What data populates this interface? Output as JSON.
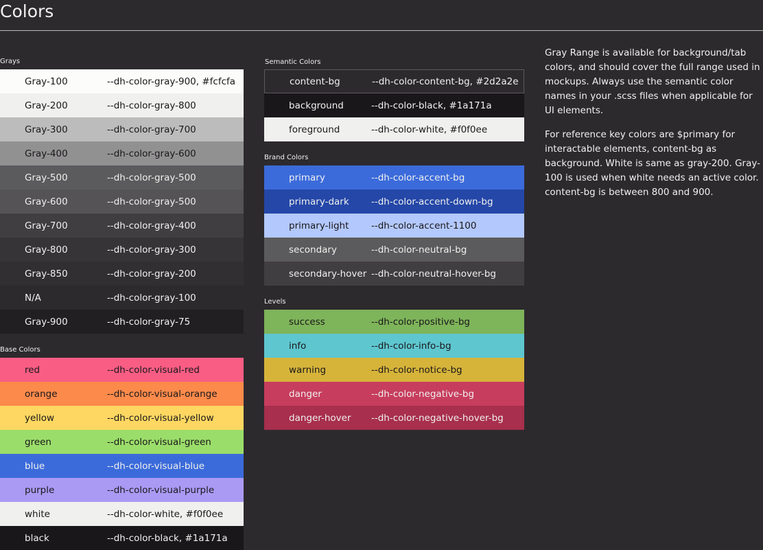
{
  "page": {
    "title": "Colors"
  },
  "grays": {
    "label": "Grays",
    "items": [
      {
        "name": "Gray-100",
        "var": "--dh-color-gray-900, #fcfcfa",
        "bg": "#fcfcfa",
        "fg": "#1a171a"
      },
      {
        "name": "Gray-200",
        "var": "--dh-color-gray-800",
        "bg": "#f0f0ee",
        "fg": "#1a171a"
      },
      {
        "name": "Gray-300",
        "var": "--dh-color-gray-700",
        "bg": "#bcbcbc",
        "fg": "#1a171a"
      },
      {
        "name": "Gray-400",
        "var": "--dh-color-gray-600",
        "bg": "#929192",
        "fg": "#1a171a"
      },
      {
        "name": "Gray-500",
        "var": "--dh-color-gray-500",
        "bg": "#5b5a5c",
        "fg": "#f0f0ee"
      },
      {
        "name": "Gray-600",
        "var": "--dh-color-gray-500",
        "bg": "#555356",
        "fg": "#f0f0ee"
      },
      {
        "name": "Gray-700",
        "var": "--dh-color-gray-400",
        "bg": "#403e41",
        "fg": "#f0f0ee"
      },
      {
        "name": "Gray-800",
        "var": "--dh-color-gray-300",
        "bg": "#373438",
        "fg": "#f0f0ee"
      },
      {
        "name": "Gray-850",
        "var": "--dh-color-gray-200",
        "bg": "#322f33",
        "fg": "#f0f0ee"
      },
      {
        "name": "N/A",
        "var": "--dh-color-gray-100",
        "bg": "#2d2a2e",
        "fg": "#f0f0ee"
      },
      {
        "name": "Gray-900",
        "var": "--dh-color-gray-75",
        "bg": "#211f22",
        "fg": "#f0f0ee"
      }
    ]
  },
  "base_colors": {
    "label": "Base Colors",
    "items": [
      {
        "name": "red",
        "var": "--dh-color-visual-red",
        "bg": "#f95d84",
        "fg": "#1a171a"
      },
      {
        "name": "orange",
        "var": "--dh-color-visual-orange",
        "bg": "#fc8a4b",
        "fg": "#1a171a"
      },
      {
        "name": "yellow",
        "var": "--dh-color-visual-yellow",
        "bg": "#fdd761",
        "fg": "#1a171a"
      },
      {
        "name": "green",
        "var": "--dh-color-visual-green",
        "bg": "#9bdd6a",
        "fg": "#1a171a"
      },
      {
        "name": "blue",
        "var": "--dh-color-visual-blue",
        "bg": "#3b6bdb",
        "fg": "#f0f0ee"
      },
      {
        "name": "purple",
        "var": "--dh-color-visual-purple",
        "bg": "#aa9af4",
        "fg": "#1a171a"
      },
      {
        "name": "white",
        "var": "--dh-color-white, #f0f0ee",
        "bg": "#f0f0ee",
        "fg": "#1a171a"
      },
      {
        "name": "black",
        "var": "--dh-color-black, #1a171a",
        "bg": "#1a171a",
        "fg": "#f0f0ee"
      }
    ]
  },
  "semantic_colors": {
    "label": "Semantic Colors",
    "items": [
      {
        "name": "content-bg",
        "var": "--dh-color-content-bg, #2d2a2e",
        "bg": "#2d2a2e",
        "fg": "#f0f0ee",
        "border": "#5b5a5c"
      },
      {
        "name": "background",
        "var": "--dh-color-black, #1a171a",
        "bg": "#1a171a",
        "fg": "#f0f0ee"
      },
      {
        "name": "foreground",
        "var": "--dh-color-white, #f0f0ee",
        "bg": "#f0f0ee",
        "fg": "#1a171a"
      }
    ]
  },
  "brand_colors": {
    "label": "Brand Colors",
    "items": [
      {
        "name": "primary",
        "var": "--dh-color-accent-bg",
        "bg": "#3b6bdb",
        "fg": "#f0f0ee"
      },
      {
        "name": "primary-dark",
        "var": "--dh-color-accent-down-bg",
        "bg": "#2447a8",
        "fg": "#f0f0ee"
      },
      {
        "name": "primary-light",
        "var": "--dh-color-accent-1100",
        "bg": "#b3c8fc",
        "fg": "#1a171a"
      },
      {
        "name": "secondary",
        "var": "--dh-color-neutral-bg",
        "bg": "#5b5a5c",
        "fg": "#f0f0ee"
      },
      {
        "name": "secondary-hover",
        "var": "--dh-color-neutral-hover-bg",
        "bg": "#403e41",
        "fg": "#f0f0ee"
      }
    ]
  },
  "levels": {
    "label": "Levels",
    "items": [
      {
        "name": "success",
        "var": "--dh-color-positive-bg",
        "bg": "#7eb45a",
        "fg": "#1a171a"
      },
      {
        "name": "info",
        "var": "--dh-color-info-bg",
        "bg": "#5ec6cf",
        "fg": "#1a171a"
      },
      {
        "name": "warning",
        "var": "--dh-color-notice-bg",
        "bg": "#d6b43a",
        "fg": "#1a171a"
      },
      {
        "name": "danger",
        "var": "--dh-color-negative-bg",
        "bg": "#c73d5e",
        "fg": "#f0f0ee"
      },
      {
        "name": "danger-hover",
        "var": "--dh-color-negative-hover-bg",
        "bg": "#a82f4d",
        "fg": "#f0f0ee"
      }
    ]
  },
  "notes": {
    "p1": "Gray Range is available for background/tab colors, and should cover the full range used in mockups. Always use the semantic color names in your .scss files when applicable for UI elements.",
    "p2": "For reference key colors are $primary for interactable elements, content-bg as background. White is same as gray-200. Gray-100 is used when white needs an active color. content-bg is between 800 and 900."
  }
}
